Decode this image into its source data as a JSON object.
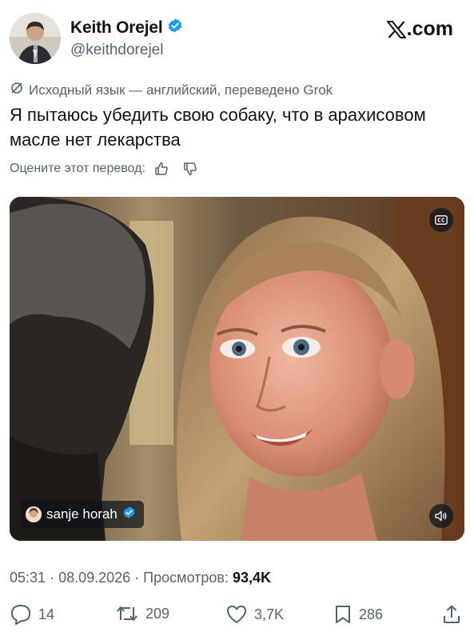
{
  "author": {
    "name": "Keith Orejel",
    "handle": "@keithdorejel",
    "verified": true
  },
  "site": {
    "logo_text": ".com",
    "brand_color": "#0f1419"
  },
  "translation": {
    "note": "Исходный язык — английский, переведено Grok",
    "rate_label": "Оцените этот перевод:"
  },
  "tweet": {
    "text": "Я пытаюсь убедить свою собаку, что в арахисовом масле нет лекарства"
  },
  "media": {
    "tag_name": "sanje horah",
    "tag_verified": true,
    "icons": [
      "closed-captions-icon",
      "volume-icon"
    ]
  },
  "meta": {
    "time": "05:31",
    "date": "08.09.2026",
    "views_label": "Просмотров:",
    "views_value": "93,4K"
  },
  "actions": {
    "replies": "14",
    "reposts": "209",
    "likes": "3,7K",
    "bookmarks": "286"
  },
  "colors": {
    "text_primary": "#0f1419",
    "text_secondary": "#536471",
    "verified_blue": "#1d9bf0"
  }
}
